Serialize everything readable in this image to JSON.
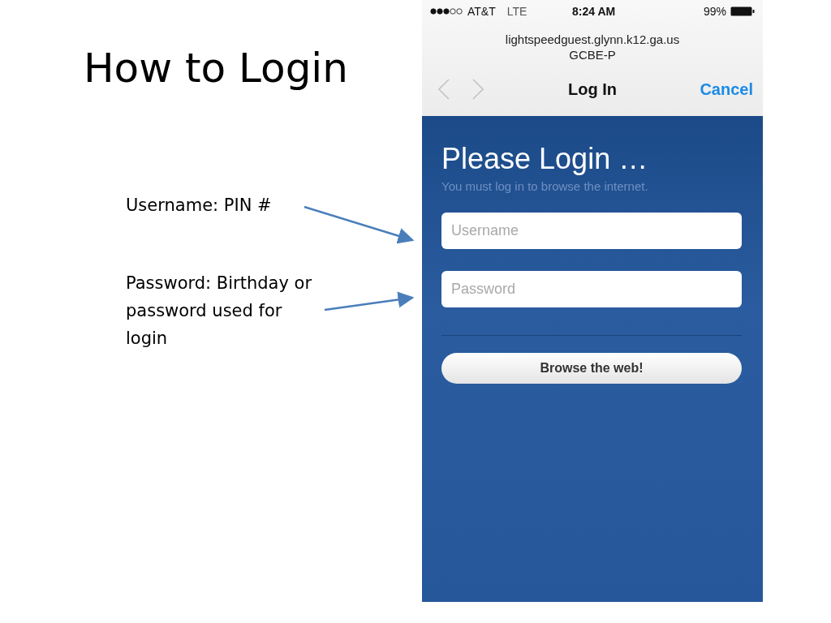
{
  "slide": {
    "title": "How to Login",
    "notes": [
      {
        "text": "Username: PIN #"
      },
      {
        "text": "Password: Birthday or password used for login"
      }
    ]
  },
  "phone": {
    "status_bar": {
      "carrier": "AT&T",
      "network": "LTE",
      "time": "8:24 AM",
      "battery": "99%"
    },
    "address": {
      "url": "lightspeedguest.glynn.k12.ga.us",
      "site": "GCBE-P"
    },
    "nav": {
      "title": "Log In",
      "cancel": "Cancel"
    },
    "login": {
      "heading": "Please Login …",
      "subtitle": "You must log in to browse the internet.",
      "fields": [
        {
          "placeholder": "Username"
        },
        {
          "placeholder": "Password"
        }
      ],
      "button": "Browse the web!"
    }
  }
}
